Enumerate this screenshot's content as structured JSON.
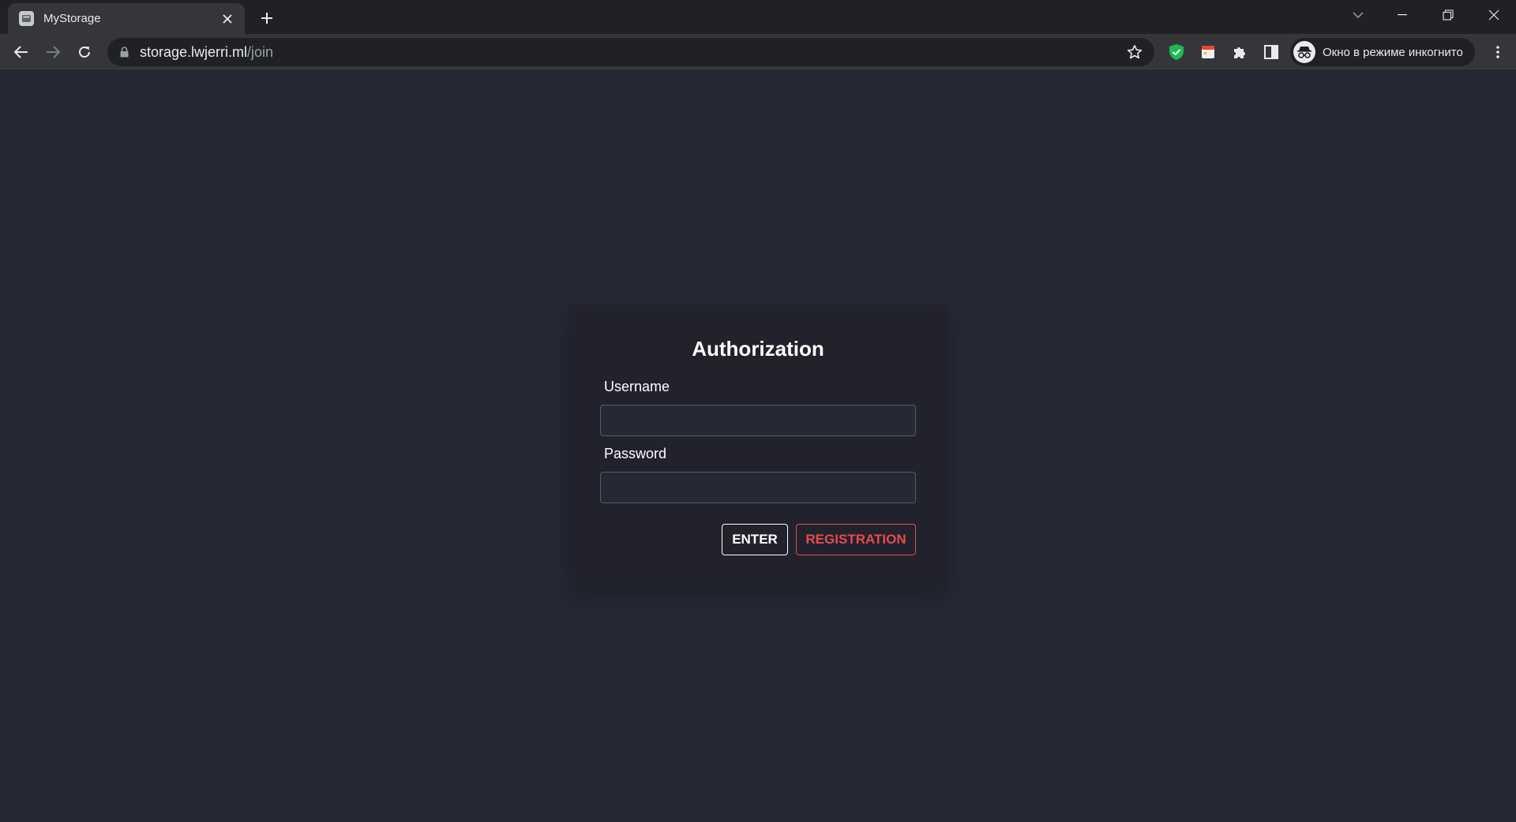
{
  "browser": {
    "tab": {
      "title": "MyStorage"
    },
    "address": {
      "host": "storage.lwjerri.ml",
      "path": "/join"
    },
    "profile": {
      "label": "Окно в режиме инкогнито"
    }
  },
  "auth": {
    "title": "Authorization",
    "username": {
      "label": "Username",
      "value": ""
    },
    "password": {
      "label": "Password",
      "value": ""
    },
    "enter_label": "ENTER",
    "registration_label": "REGISTRATION"
  },
  "colors": {
    "page_bg": "#262834",
    "card_bg": "#21222c",
    "accent_red": "#e84b50",
    "chrome_dark": "#202124",
    "chrome_toolbar": "#35363a"
  },
  "icons": [
    "tab-favicon-icon",
    "close-icon",
    "plus-icon",
    "chevron-down-icon",
    "minimize-icon",
    "restore-icon",
    "back-icon",
    "forward-icon",
    "reload-icon",
    "lock-icon",
    "star-icon",
    "shield-extension-icon",
    "calendar-extension-icon",
    "puzzle-icon",
    "side-panel-icon",
    "incognito-icon",
    "kebab-menu-icon"
  ]
}
